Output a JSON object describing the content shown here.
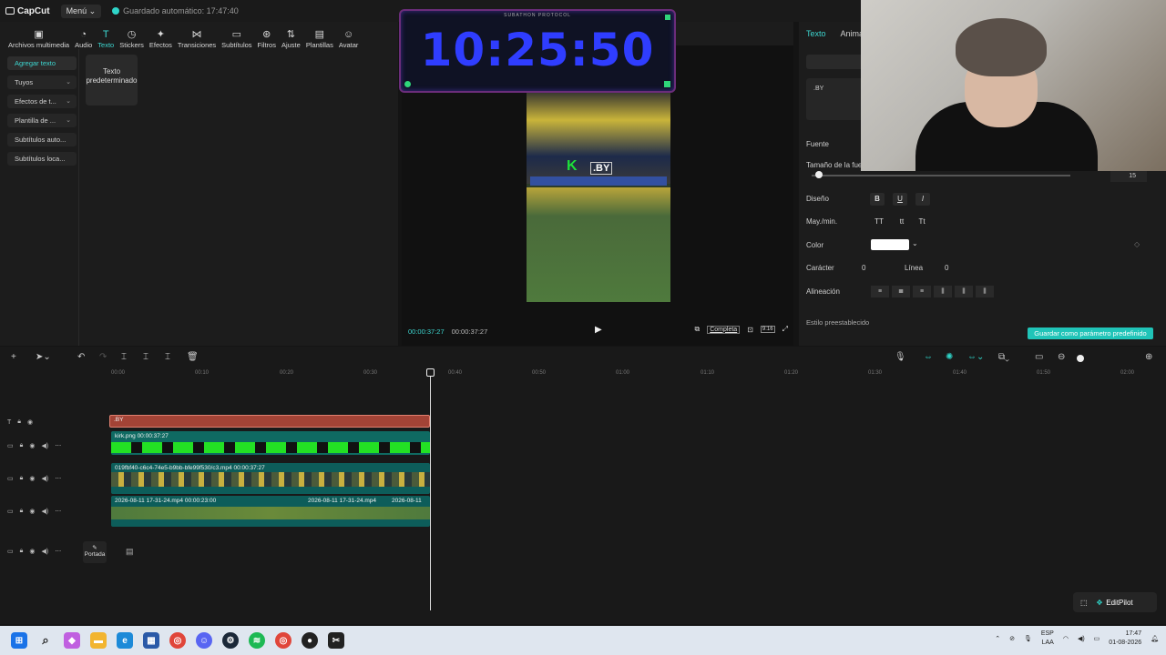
{
  "app": {
    "logo": "CapCut",
    "menu_label": "Menú",
    "autosave": "Guardado automático: 17:47:40"
  },
  "toolbar": {
    "items": [
      {
        "label": "Archivos multimedia",
        "icon": "media-icon"
      },
      {
        "label": "Audio",
        "icon": "audio-icon"
      },
      {
        "label": "Texto",
        "icon": "text-icon",
        "active": true
      },
      {
        "label": "Stickers",
        "icon": "sticker-icon"
      },
      {
        "label": "Efectos",
        "icon": "effects-icon"
      },
      {
        "label": "Transiciones",
        "icon": "transitions-icon"
      },
      {
        "label": "Subtítulos",
        "icon": "subtitles-icon"
      },
      {
        "label": "Filtros",
        "icon": "filters-icon"
      },
      {
        "label": "Ajuste",
        "icon": "adjust-icon"
      },
      {
        "label": "Plantillas",
        "icon": "templates-icon"
      },
      {
        "label": "Avatar",
        "icon": "avatar-icon"
      }
    ]
  },
  "sidebar": {
    "items": [
      {
        "label": "Agregar texto",
        "active": true
      },
      {
        "label": "Tuyos"
      },
      {
        "label": "Efectos de t..."
      },
      {
        "label": "Plantilla de ..."
      },
      {
        "label": "Subtítulos auto..."
      },
      {
        "label": "Subtítulos loca..."
      }
    ]
  },
  "preset": {
    "label": "Texto predeterminado"
  },
  "preview": {
    "timer_title": "SUBATHON PROTOCOL",
    "timer_value": "10:25:50",
    "overlay_k": "K",
    "overlay_by": ".BY",
    "current_time": "00:00:37:27",
    "total_time": "00:00:37:27",
    "complete_label": "Completa",
    "ratio_label": "9:16"
  },
  "inspector": {
    "tab_text": "Texto",
    "tab_anim": "Anima",
    "basic_btn": "Bá",
    "text_value": ".BY",
    "font_label": "Fuente",
    "size_label": "Tamaño de la fuen",
    "size_value": "15",
    "design_label": "Diseño",
    "bold": "B",
    "underline": "U",
    "italic": "I",
    "case_label": "May./min.",
    "case_upper": "TT",
    "case_lower": "tt",
    "case_title": "Tt",
    "color_label": "Color",
    "color_value": "#ffffff",
    "char_label": "Carácter",
    "char_value": "0",
    "line_label": "Línea",
    "line_value": "0",
    "align_label": "Alineación",
    "preset_label": "Estilo preestablecido",
    "save_preset": "Guardar como parámetro predefinido"
  },
  "timeline": {
    "ticks": [
      "00:00",
      "00:10",
      "00:20",
      "00:30",
      "00:40",
      "00:50",
      "01:00",
      "01:10",
      "01:20",
      "01:30",
      "01:40",
      "01:50",
      "02:00"
    ],
    "text_clip": ".BY",
    "green_clip": "kirk.png  00:00:37:27",
    "video1_clip": "019fbf40-c6c4-74e5-b9bb-bfe99f530/c3.mp4  00:00:37:27",
    "video2_clip_a": "2026-08-11 17-31-24.mp4  00:00:23:00",
    "video2_clip_b": "2026-08-11 17-31-24.mp4",
    "video2_clip_c": "2026-08-11",
    "cover_label": "Portada",
    "editpilot": "EditPilot"
  },
  "taskbar": {
    "lang_top": "ESP",
    "lang_bottom": "LAA",
    "time": "17:47",
    "date": "01-08-2026"
  },
  "colors": {
    "accent": "#2fd5c9",
    "timer_text": "#2f3dff",
    "text_clip": "#a34336",
    "green_screen": "#23e024"
  }
}
